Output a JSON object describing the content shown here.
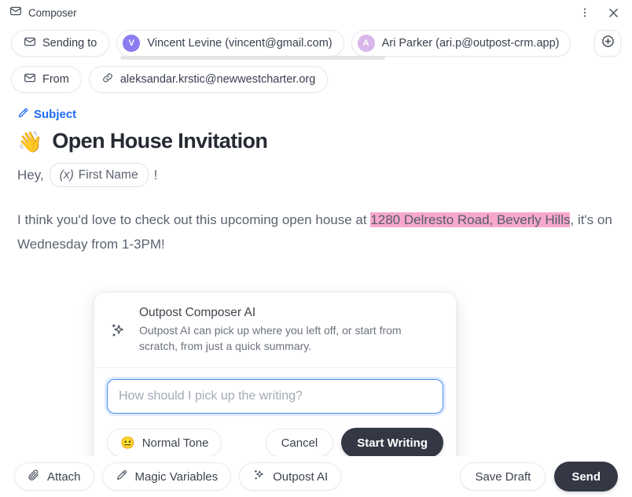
{
  "window": {
    "title": "Composer",
    "icon": "envelope-icon",
    "menu_icon": "more-vertical-icon",
    "close_icon": "close-icon"
  },
  "recipients": {
    "sending_to_label": "Sending to",
    "sending_to_icon": "envelope-icon",
    "add_icon": "plus-circle-icon",
    "people": [
      {
        "initial": "V",
        "name": "Vincent Levine (vincent@gmail.com)",
        "color": "#8b7cf0"
      },
      {
        "initial": "A",
        "name": "Ari Parker (ari.p@outpost-crm.app)",
        "color": "#d9b6ea"
      }
    ]
  },
  "from": {
    "label": "From",
    "label_icon": "envelope-icon",
    "value": "aleksandar.krstic@newwestcharter.org",
    "value_icon": "link-icon"
  },
  "subject": {
    "label": "Subject",
    "label_icon": "pen-icon",
    "emoji": "👋",
    "text": "Open House Invitation"
  },
  "body": {
    "greeting_prefix": "Hey,",
    "variable_prefix": "(x)",
    "variable_label": "First Name",
    "greeting_suffix": "!",
    "paragraph_part1": "I think you'd love to check out this upcoming open house at ",
    "paragraph_highlight": "1280 Delresto Road, Beverly Hills",
    "paragraph_part2": ", it's on Wednesday from 1-3PM!",
    "highlight_color": "#f7a8cc"
  },
  "ai_card": {
    "icon": "sparkle-icon",
    "title": "Outpost Composer AI",
    "description": "Outpost AI can pick up where you left off, or start from scratch, from just a quick summary.",
    "input_placeholder": "How should I pick up the writing?",
    "input_value": "",
    "tone_emoji": "😐",
    "tone_label": "Normal Tone",
    "cancel_label": "Cancel",
    "submit_label": "Start Writing",
    "accent_color": "#4a8df0"
  },
  "toolbar": {
    "attach_label": "Attach",
    "attach_icon": "paperclip-icon",
    "magic_variables_label": "Magic Variables",
    "magic_variables_icon": "pen-icon",
    "outpost_ai_label": "Outpost AI",
    "outpost_ai_icon": "sparkle-icon",
    "save_draft_label": "Save Draft",
    "send_label": "Send"
  }
}
